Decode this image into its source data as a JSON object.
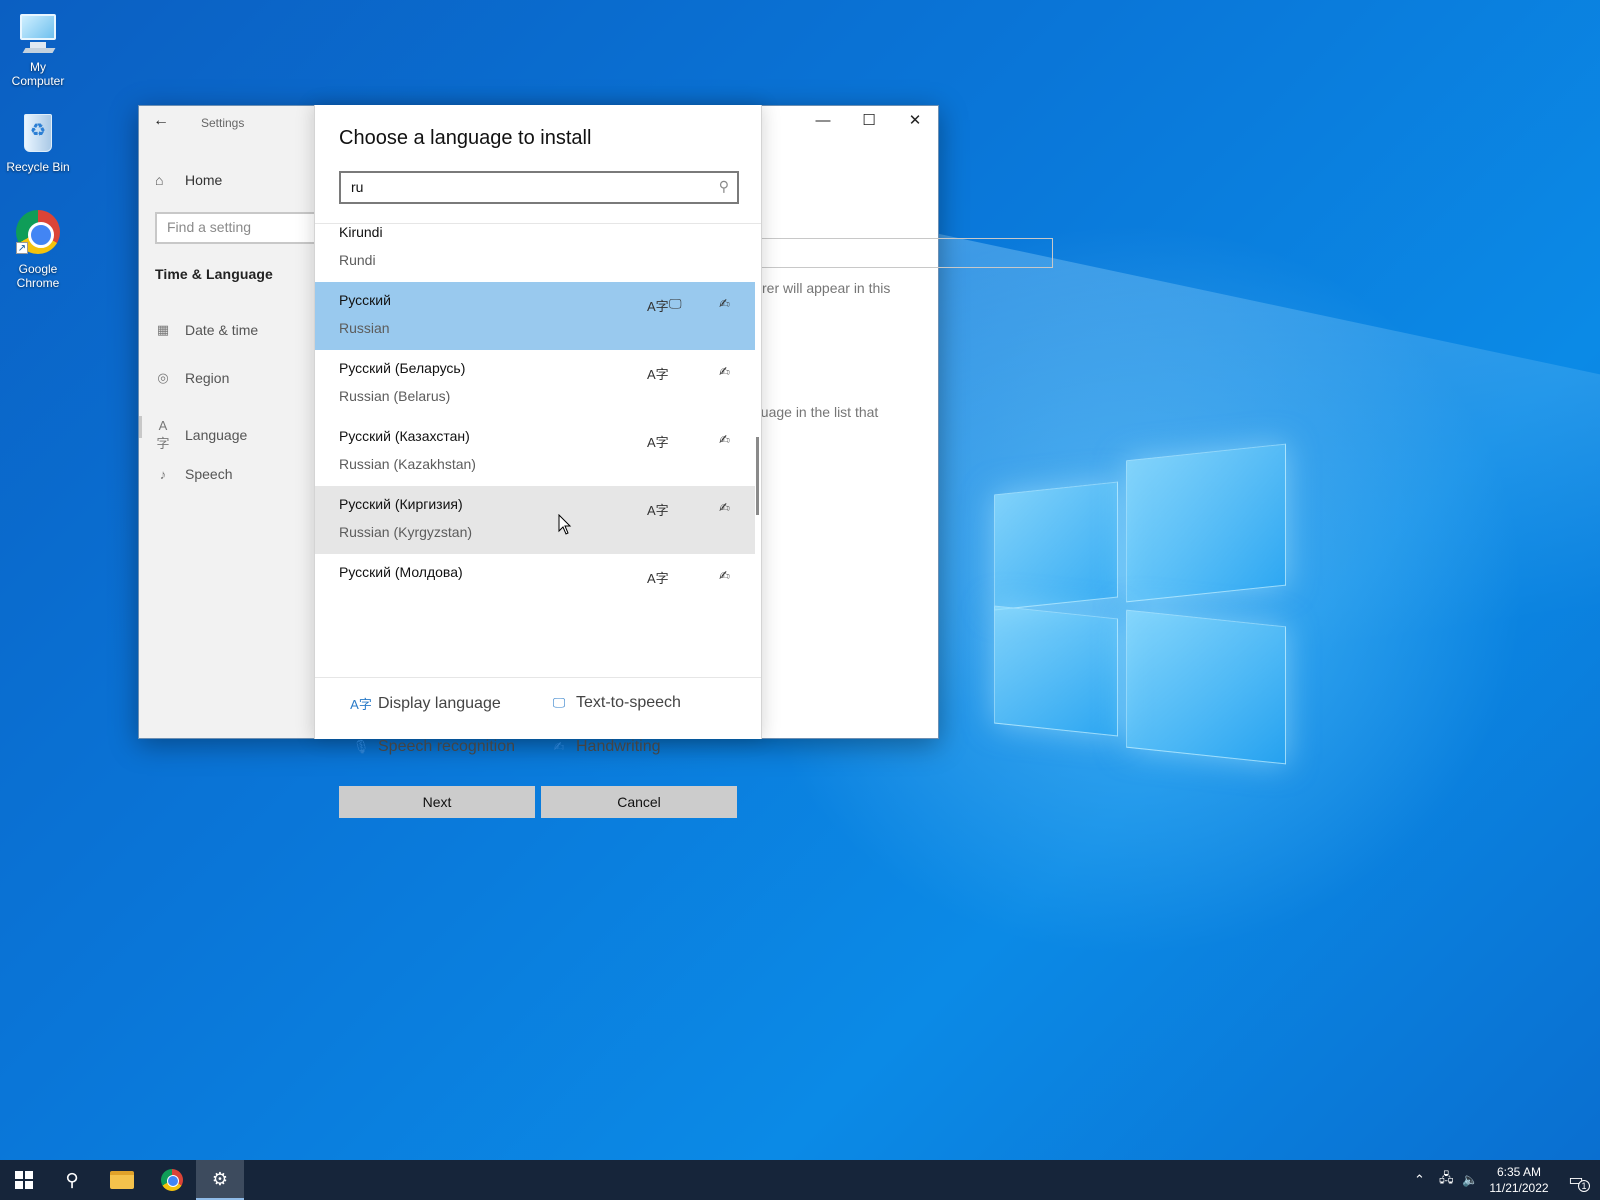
{
  "desktop": {
    "icons": [
      {
        "label_line1": "My",
        "label_line2": "Computer"
      },
      {
        "label_line1": "Recycle Bin",
        "label_line2": ""
      },
      {
        "label_line1": "Google",
        "label_line2": "Chrome"
      }
    ]
  },
  "settings": {
    "title": "Settings",
    "home": "Home",
    "find_placeholder": "Find a setting",
    "section": "Time & Language",
    "nav": [
      "Date & time",
      "Region",
      "Language",
      "Speech"
    ],
    "bg_text1": "rer will appear in this",
    "bg_text2": "guage in the list that"
  },
  "dialog": {
    "title": "Choose a language to install",
    "search_value": "ru",
    "languages": [
      {
        "native": "Kirundi",
        "english": "Rundi"
      },
      {
        "native": "Русский",
        "english": "Russian"
      },
      {
        "native": "Русский (Беларусь)",
        "english": "Russian (Belarus)"
      },
      {
        "native": "Русский (Казахстан)",
        "english": "Russian (Kazakhstan)"
      },
      {
        "native": "Русский (Киргизия)",
        "english": "Russian (Kyrgyzstan)"
      },
      {
        "native": "Русский (Молдова)",
        "english": ""
      }
    ],
    "legend": {
      "display": "Display language",
      "tts": "Text-to-speech",
      "speech": "Speech recognition",
      "handwriting": "Handwriting"
    },
    "next": "Next",
    "cancel": "Cancel"
  },
  "taskbar": {
    "time": "6:35 AM",
    "date": "11/21/2022",
    "notification_count": "1"
  },
  "icons": {
    "display_language": "A字",
    "text_to_speech": "🖵",
    "handwriting": "✍",
    "speech": "🎙"
  }
}
